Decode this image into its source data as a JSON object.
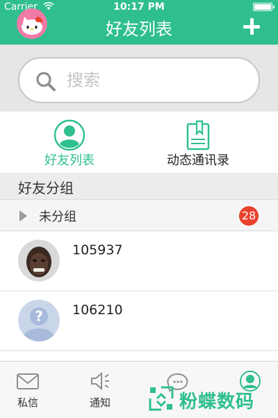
{
  "status_bar": {
    "carrier": "Carrier",
    "time": "10:17 PM"
  },
  "header": {
    "title": "好友列表",
    "add_icon": "plus-icon",
    "avatar_icon": "hello-kitty-avatar",
    "background_color": "#2fbf8f"
  },
  "search": {
    "placeholder": "搜索",
    "value": "",
    "icon": "search-icon"
  },
  "tabs": [
    {
      "label": "好友列表",
      "icon": "person-icon",
      "selected": true
    },
    {
      "label": "动态通讯录",
      "icon": "clipboard-icon",
      "selected": false
    }
  ],
  "group_section": {
    "title": "好友分组",
    "groups": [
      {
        "name": "未分组",
        "count": "28",
        "expanded": false
      }
    ]
  },
  "friends": [
    {
      "name": "105937",
      "avatar": "photo-avatar"
    },
    {
      "name": "106210",
      "avatar": "default-question-avatar"
    }
  ],
  "tabbar": {
    "items": [
      {
        "label": "私信",
        "icon": "mail-icon"
      },
      {
        "label": "通知",
        "icon": "speaker-icon"
      },
      {
        "label": "",
        "icon": "chat-bubble-icon"
      },
      {
        "label": "",
        "icon": "contacts-icon"
      }
    ]
  },
  "watermark": {
    "text": "粉蝶数码"
  },
  "colors": {
    "accent": "#2fbf8f",
    "badge": "#e8412c"
  }
}
